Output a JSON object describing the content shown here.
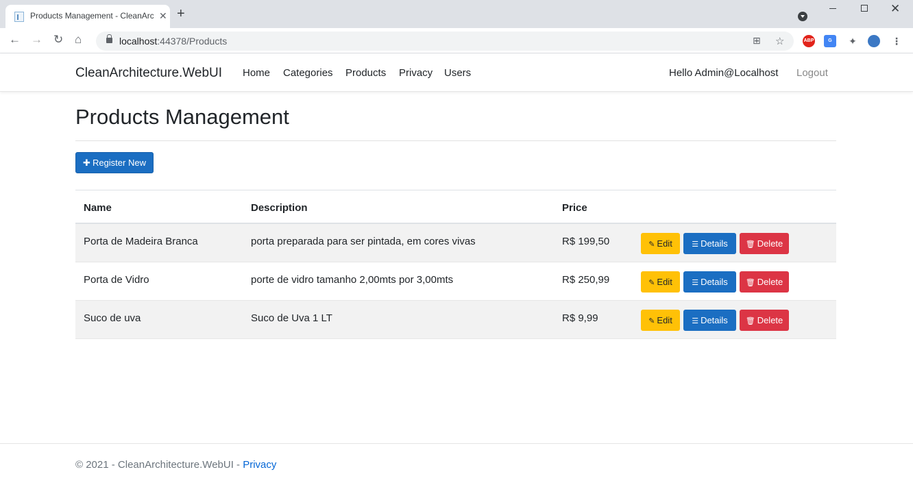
{
  "browser": {
    "tab_title": "Products Management - CleanArchitecture.WebUI",
    "url_host": "localhost",
    "url_rest": ":44378/Products"
  },
  "navbar": {
    "brand": "CleanArchitecture.WebUI",
    "links": [
      "Home",
      "Categories",
      "Products",
      "Privacy",
      "Users"
    ],
    "greeting": "Hello Admin@Localhost",
    "logout": "Logout"
  },
  "main": {
    "title": "Products Management",
    "register_button": "Register New",
    "columns": [
      "Name",
      "Description",
      "Price"
    ],
    "rows": [
      {
        "name": "Porta de Madeira Branca",
        "description": "porta preparada para ser pintada, em cores vivas",
        "price": "R$ 199,50"
      },
      {
        "name": "Porta de Vidro",
        "description": "porte de vidro tamanho 2,00mts por 3,00mts",
        "price": "R$ 250,99"
      },
      {
        "name": "Suco de uva",
        "description": "Suco de Uva 1 LT",
        "price": "R$ 9,99"
      }
    ],
    "actions": {
      "edit": "Edit",
      "details": "Details",
      "delete": "Delete"
    }
  },
  "footer": {
    "text": "© 2021 - CleanArchitecture.WebUI - ",
    "link": "Privacy"
  },
  "colors": {
    "primary": "#1b6ec2",
    "warning": "#ffc107",
    "danger": "#dc3545"
  },
  "icons": [
    "tab-favicon-icon",
    "back-icon",
    "forward-icon",
    "reload-icon",
    "home-icon",
    "lock-icon",
    "translate-icon",
    "star-icon",
    "abp-icon",
    "google-translate-icon",
    "extensions-icon",
    "profile-icon",
    "menu-icon",
    "plus-icon",
    "pencil-icon",
    "list-icon",
    "trash-icon"
  ]
}
